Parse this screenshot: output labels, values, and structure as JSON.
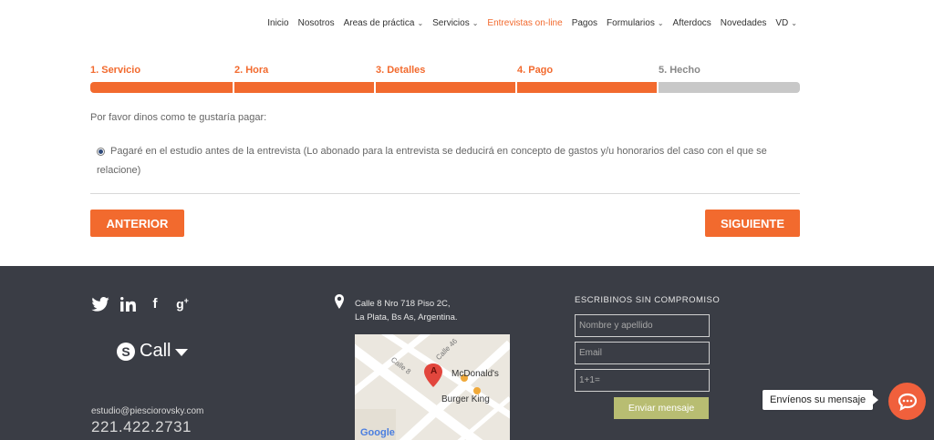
{
  "nav": {
    "items": [
      {
        "label": "Inicio",
        "dropdown": false,
        "active": false
      },
      {
        "label": "Nosotros",
        "dropdown": false,
        "active": false
      },
      {
        "label": "Areas de práctica",
        "dropdown": true,
        "active": false
      },
      {
        "label": "Servicios",
        "dropdown": true,
        "active": false
      },
      {
        "label": "Entrevistas on-line",
        "dropdown": false,
        "active": true
      },
      {
        "label": "Pagos",
        "dropdown": false,
        "active": false
      },
      {
        "label": "Formularios",
        "dropdown": true,
        "active": false
      },
      {
        "label": "Afterdocs",
        "dropdown": false,
        "active": false
      },
      {
        "label": "Novedades",
        "dropdown": false,
        "active": false
      },
      {
        "label": "VD",
        "dropdown": true,
        "active": false
      }
    ]
  },
  "steps": [
    {
      "label": "1. Servicio",
      "status": "complete"
    },
    {
      "label": "2. Hora",
      "status": "complete"
    },
    {
      "label": "3. Detalles",
      "status": "complete"
    },
    {
      "label": "4. Pago",
      "status": "current"
    },
    {
      "label": "5. Hecho",
      "status": "pending"
    }
  ],
  "payment": {
    "prompt": "Por favor dinos como te gustaría pagar:",
    "option_line1": "Pagaré en el estudio antes de la entrevista (Lo abonado para la entrevista se deducirá en concepto de gastos y/u honorarios del caso con el que se",
    "option_line2": "relacione)",
    "selected": true
  },
  "buttons": {
    "prev": "ANTERIOR",
    "next": "SIGUIENTE"
  },
  "footer": {
    "social_icons": [
      "twitter-icon",
      "linkedin-icon",
      "facebook-icon",
      "google-plus-icon"
    ],
    "call_label": "Call",
    "email": "estudio@piesciorovsky.com",
    "phone": "221.422.2731",
    "address_line1": "Calle 8 Nro 718 Piso 2C,",
    "address_line2": "La Plata, Bs As, Argentina.",
    "map": {
      "marker": "A",
      "poi1": "McDonald's",
      "poi2": "Burger King",
      "street1": "Calle 8",
      "street2": "Calle 46",
      "logo": "Google"
    },
    "form": {
      "title": "ESCRIBINOS SIN COMPROMISO",
      "name_placeholder": "Nombre y apellido",
      "email_placeholder": "Email",
      "captcha_placeholder": "1+1=",
      "send_label": "Enviar mensaje"
    }
  },
  "chat": {
    "label": "Envíenos su mensaje"
  },
  "colors": {
    "accent": "#f26a2e",
    "footer_bg": "#3a3d45",
    "send_button": "#b8bd72",
    "chat_button": "#f0603c"
  }
}
